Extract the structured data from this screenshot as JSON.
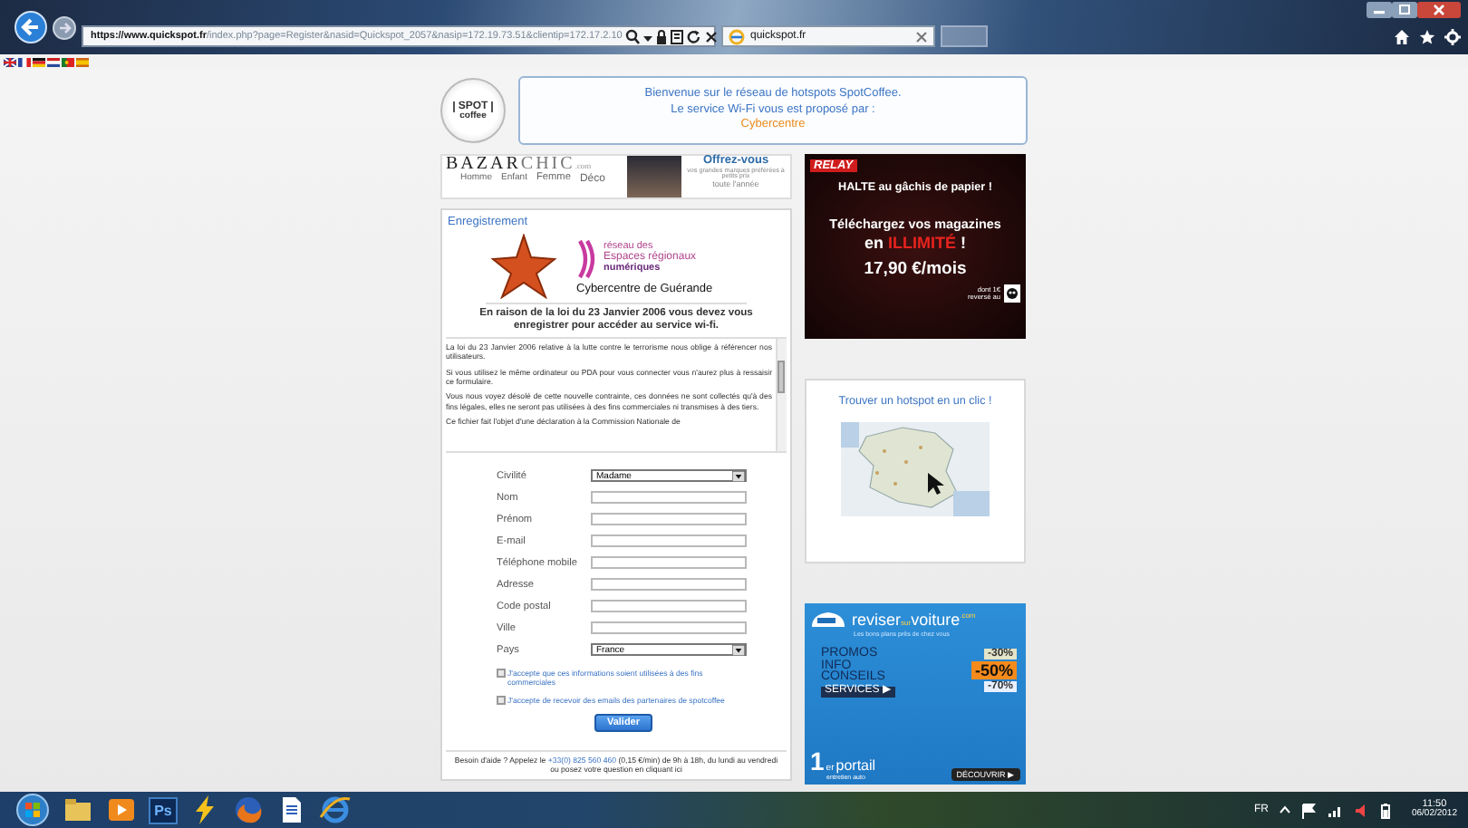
{
  "browser": {
    "address": {
      "secure_prefix": "https://",
      "url_host": "www.quickspot.fr",
      "url_path": "/index.php?page=Register&nasid=Quickspot_2057&nasip=172.19.73.51&clientip=172.17.2.10"
    },
    "tabs": [
      {
        "label": "quickspot.fr",
        "selected": true
      }
    ]
  },
  "languages": [
    {
      "kind": "uk"
    },
    {
      "kind": "fr"
    },
    {
      "kind": "de"
    },
    {
      "kind": "nl"
    },
    {
      "kind": "pt"
    },
    {
      "kind": "es"
    }
  ],
  "logo": {
    "line1": "SPOT",
    "line2": "coffee"
  },
  "welcome": {
    "line1": "Bienvenue sur le réseau de hotspots SpotCoffee.",
    "line2": "Le service Wi-Fi vous est proposé par :",
    "provider": "Cybercentre"
  },
  "banner": {
    "brand_a": "BAZAR",
    "brand_b": "CHIC",
    "brand_tld": ".com",
    "categories": [
      "Homme",
      "Enfant",
      "Femme",
      "Déco"
    ],
    "headline": "Offrez-vous",
    "tagline": "vos grandes marques préférées à petits prix",
    "tagline2": "toute l'année"
  },
  "register": {
    "title": "Enregistrement",
    "partner": {
      "line1": "réseau des",
      "line2": "Espaces régionaux",
      "line3": "numériques",
      "place": "Cybercentre de Guérande"
    },
    "notice": "En raison de la loi du 23 Janvier 2006 vous devez vous enregistrer pour accéder au service wi-fi.",
    "legal": [
      "La loi du 23 Janvier 2006 relative à la lutte contre le terrorisme nous oblige à référencer nos utilisateurs.",
      "Si vous utilisez le même ordinateur ou PDA pour vous connecter vous n'aurez plus à ressaisir ce formulaire.",
      "Vous nous voyez désolé de cette nouvelle contrainte, ces données ne sont collectés qu'à des fins légales, elles ne seront pas utilisées à des fins commerciales ni transmises à des tiers.",
      "Ce fichier fait l'objet d'une déclaration à la Commission Nationale de"
    ],
    "fields": [
      {
        "label": "Civilité",
        "kind": "select",
        "value": "Madame"
      },
      {
        "label": "Nom",
        "kind": "text"
      },
      {
        "label": "Prénom",
        "kind": "text"
      },
      {
        "label": "E-mail",
        "kind": "text"
      },
      {
        "label": "Téléphone mobile",
        "kind": "text"
      },
      {
        "label": "Adresse",
        "kind": "text"
      },
      {
        "label": "Code postal",
        "kind": "text"
      },
      {
        "label": "Ville",
        "kind": "text"
      },
      {
        "label": "Pays",
        "kind": "select",
        "value": "France"
      }
    ],
    "consents": [
      {
        "label": "J'accepte que ces informations soient utilisées à des fins commerciales",
        "checked": false
      },
      {
        "label": "J'accepte de recevoir des emails des partenaires de spotcoffee",
        "checked": false
      }
    ],
    "submit": "Valider",
    "help": {
      "before": "Besoin d'aide ? Appelez le ",
      "phone": "+33(0) 825 560 460",
      "after": " (0,15 €/min) de 9h à 18h, du lundi au vendredi",
      "ask": "ou posez votre question en cliquant ici"
    }
  },
  "ads": {
    "relay": {
      "brand": "RELAY",
      "line1": "HALTE au gâchis de papier !",
      "line2": "Téléchargez vos magazines",
      "line3_before": "en ",
      "line3_highlight": "ILLIMITÉ",
      "line3_after": " !",
      "price": "17,90 €/mois",
      "donation": "dont 1€ reversé au"
    },
    "hotspot": {
      "title": "Trouver un hotspot en un clic !"
    },
    "reviser": {
      "brand_a": "reviser",
      "brand_b": "sur",
      "brand_c": "voiture",
      "tld": ".com",
      "tagline": "Les bons plans près de chez vous",
      "lines": [
        "PROMOS",
        "INFO",
        "CONSEILS"
      ],
      "services": "SERVICES ▶",
      "stickers": [
        "-30%",
        "-50%",
        "-70%"
      ],
      "rank": "1",
      "rank_sup": "er",
      "portal": "portail",
      "portal_sub": "entretien auto",
      "cta": "DÉCOUVRIR ▶"
    }
  },
  "taskbar": {
    "apps": [
      {
        "kind": "explorer"
      },
      {
        "kind": "media"
      },
      {
        "kind": "photoshop",
        "label": "Ps"
      },
      {
        "kind": "tool"
      },
      {
        "kind": "firefox"
      },
      {
        "kind": "document"
      },
      {
        "kind": "ie"
      }
    ],
    "language": "FR",
    "time": "11:50",
    "date": "06/02/2012"
  }
}
